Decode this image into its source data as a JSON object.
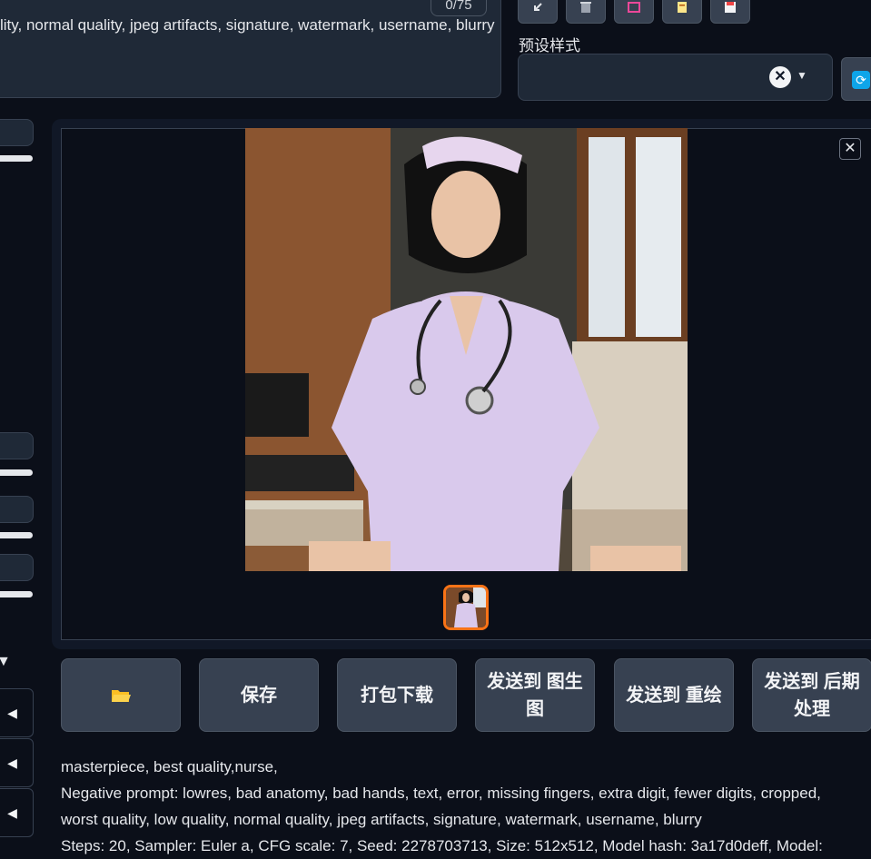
{
  "negative_prompt_box": {
    "text": "lity, normal quality, jpeg artifacts, signature, watermark, username, blurry",
    "token_counter": "0/75"
  },
  "toolbar_icons": [
    "arrow-icon",
    "trash-icon",
    "image-icon",
    "clipboard-icon",
    "save-icon"
  ],
  "styles": {
    "label": "预设样式",
    "value": "",
    "clear_symbol": "✕",
    "caret": "▼"
  },
  "refresh_icon": "refresh-icon",
  "gallery": {
    "close_symbol": "✕",
    "image_alt": "nurse"
  },
  "actions": {
    "folder_icon": "folder-icon",
    "save": "保存",
    "zip": "打包下载",
    "send_img2img": "发送到 图生图",
    "send_inpaint": "发送到 重绘",
    "send_extras": "发送到 后期处理"
  },
  "left_controls": {
    "triangle": "▼",
    "arrow": "◀"
  },
  "info": {
    "prompt": "masterpiece, best quality,nurse,",
    "negative": "Negative prompt: lowres, bad anatomy, bad hands, text, error, missing fingers, extra digit, fewer digits, cropped, worst quality, low quality, normal quality, jpeg artifacts, signature, watermark, username, blurry",
    "params": "Steps: 20, Sampler: Euler a, CFG scale: 7, Seed: 2278703713, Size: 512x512, Model hash: 3a17d0deff, Model:"
  },
  "colors": {
    "background": "#0b0f19",
    "panel": "#1f2937",
    "button": "#374151",
    "accent_orange": "#f97316",
    "accent_blue": "#0ea5e9"
  }
}
